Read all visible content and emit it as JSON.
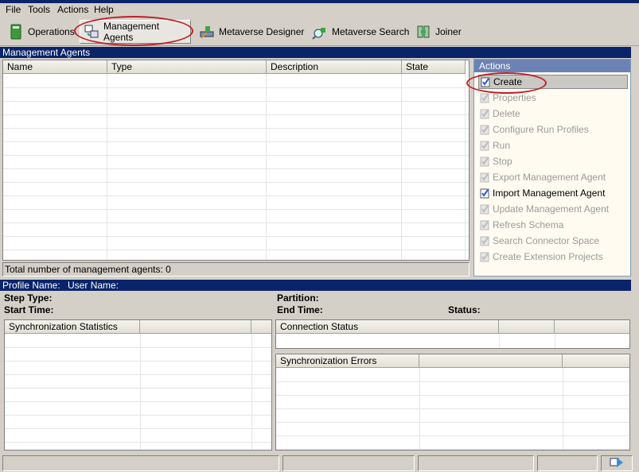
{
  "menu": {
    "file": "File",
    "tools": "Tools",
    "actions": "Actions",
    "help": "Help"
  },
  "toolbar": {
    "operations": "Operations",
    "management_agents": "Management Agents",
    "metaverse_designer": "Metaverse Designer",
    "metaverse_search": "Metaverse Search",
    "joiner": "Joiner"
  },
  "ma_panel": {
    "title": "Management Agents",
    "columns": [
      "Name",
      "Type",
      "Description",
      "State"
    ],
    "total_label": "Total number of management agents: 0"
  },
  "actions": {
    "title": "Actions",
    "items": [
      {
        "label": "Create",
        "state": "selected"
      },
      {
        "label": "Properties",
        "state": "disabled"
      },
      {
        "label": "Delete",
        "state": "disabled"
      },
      {
        "label": "Configure Run Profiles",
        "state": "disabled"
      },
      {
        "label": "Run",
        "state": "disabled"
      },
      {
        "label": "Stop",
        "state": "disabled"
      },
      {
        "label": "Export Management Agent",
        "state": "disabled"
      },
      {
        "label": "Import Management Agent",
        "state": "enabled"
      },
      {
        "label": "Update Management Agent",
        "state": "disabled"
      },
      {
        "label": "Refresh Schema",
        "state": "disabled"
      },
      {
        "label": "Search Connector Space",
        "state": "disabled"
      },
      {
        "label": "Create Extension Projects",
        "state": "disabled"
      }
    ]
  },
  "profile": {
    "profile_name_label": "Profile Name:",
    "user_name_label": "User Name:",
    "step_type": "Step Type:",
    "start_time": "Start Time:",
    "partition": "Partition:",
    "end_time": "End Time:",
    "status": "Status:"
  },
  "sync_stats": {
    "header": "Synchronization Statistics"
  },
  "connection_status": {
    "header": "Connection Status"
  },
  "sync_errors": {
    "header": "Synchronization Errors"
  },
  "colors": {
    "title_bar": "#0a246a",
    "highlight_oval": "#c0202a",
    "actions_bg": "#fffbf0"
  }
}
